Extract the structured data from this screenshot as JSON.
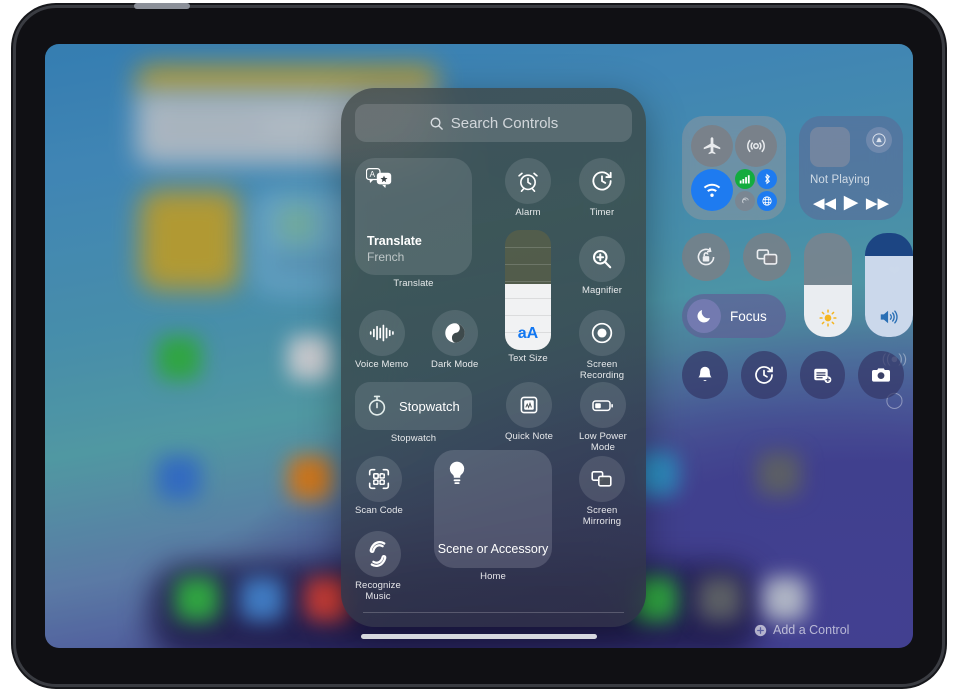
{
  "device": {
    "name": "ipad",
    "orientation": "landscape"
  },
  "search": {
    "placeholder": "Search Controls",
    "icon": "search-icon"
  },
  "controls_gallery": {
    "translate_widget": {
      "icon": "translate-icon",
      "title": "Translate",
      "subtitle": "French",
      "label": "Translate"
    },
    "tiles": [
      {
        "name": "alarm",
        "label": "Alarm",
        "icon": "alarm-clock-icon"
      },
      {
        "name": "timer",
        "label": "Timer",
        "icon": "timer-icon"
      },
      {
        "name": "magnifier",
        "label": "Magnifier",
        "icon": "magnifier-icon"
      },
      {
        "name": "voice-memo",
        "label": "Voice Memo",
        "icon": "waveform-icon"
      },
      {
        "name": "dark-mode",
        "label": "Dark Mode",
        "icon": "circle-half-icon"
      },
      {
        "name": "screen-recording",
        "label": "Screen\nRecording",
        "icon": "record-dot-icon"
      },
      {
        "name": "quick-note",
        "label": "Quick Note",
        "icon": "note-icon"
      },
      {
        "name": "low-power-mode",
        "label": "Low Power\nMode",
        "icon": "battery-icon"
      },
      {
        "name": "scan-code",
        "label": "Scan Code",
        "icon": "qr-code-icon"
      },
      {
        "name": "screen-mirroring",
        "label": "Screen\nMirroring",
        "icon": "screen-mirroring-icon"
      },
      {
        "name": "recognize-music",
        "label": "Recognize\nMusic",
        "icon": "shazam-icon"
      }
    ],
    "text_size": {
      "label": "Text Size",
      "glyph": "aA",
      "fill_percent": 55,
      "steps": 7
    },
    "stopwatch": {
      "button_label": "Stopwatch",
      "label": "Stopwatch",
      "icon": "stopwatch-icon"
    },
    "home_widget": {
      "title": "Scene or Accessory",
      "label": "Home",
      "icon": "lightbulb-icon"
    }
  },
  "control_center": {
    "connectivity": {
      "airplane_mode": {
        "label": "Airplane Mode",
        "icon": "airplane-icon",
        "state": "off"
      },
      "airdrop": {
        "label": "AirDrop",
        "icon": "airdrop-icon",
        "state": "off"
      },
      "wifi": {
        "label": "Wi-Fi",
        "icon": "wifi-icon",
        "state": "on"
      },
      "cellular_data": {
        "label": "Cellular Data",
        "icon": "cellular-bars-icon",
        "state": "on"
      },
      "bluetooth": {
        "label": "Bluetooth",
        "icon": "bluetooth-icon",
        "state": "on"
      },
      "personal_hotspot": {
        "label": "Personal Hotspot",
        "icon": "hotspot-icon",
        "state": "off"
      },
      "vpn": {
        "label": "VPN",
        "icon": "globe-icon",
        "state": "on"
      }
    },
    "now_playing": {
      "title": "Not Playing",
      "airplay_icon": "airplay-audio-icon",
      "rewind_icon": "rewind-icon",
      "play_icon": "play-icon",
      "forward_icon": "fast-forward-icon"
    },
    "rotation_lock": {
      "label": "Rotation Lock",
      "icon": "rotation-lock-icon"
    },
    "screen_mirroring": {
      "label": "Screen Mirroring",
      "icon": "screen-mirroring-icon"
    },
    "focus": {
      "label": "Focus",
      "icon": "moon-icon"
    },
    "brightness": {
      "label": "Brightness",
      "icon": "sun-icon",
      "value_percent": 50
    },
    "volume": {
      "label": "Volume",
      "icon": "speaker-wave-icon",
      "value_percent": 78
    },
    "quick_buttons": [
      {
        "name": "silent-mode",
        "label": "Silent Mode",
        "icon": "bell-icon"
      },
      {
        "name": "timer",
        "label": "Timer",
        "icon": "timer-icon"
      },
      {
        "name": "quick-note",
        "label": "Quick Note",
        "icon": "note-add-icon"
      },
      {
        "name": "camera",
        "label": "Camera",
        "icon": "camera-icon"
      }
    ],
    "add_control": {
      "label": "Add a Control",
      "icon": "plus-circle-icon"
    }
  },
  "edge_icons": [
    {
      "name": "heart-icon"
    },
    {
      "name": "music-note-icon"
    },
    {
      "name": "broadcast-icon"
    },
    {
      "name": "circle-icon"
    }
  ],
  "colors": {
    "accent_blue": "#1e7bf0",
    "cellular_green": "#13ac3f",
    "text_size_blue": "#1277f2",
    "sun_yellow": "#f5b51f",
    "volume_blue": "#2a6fb5"
  }
}
